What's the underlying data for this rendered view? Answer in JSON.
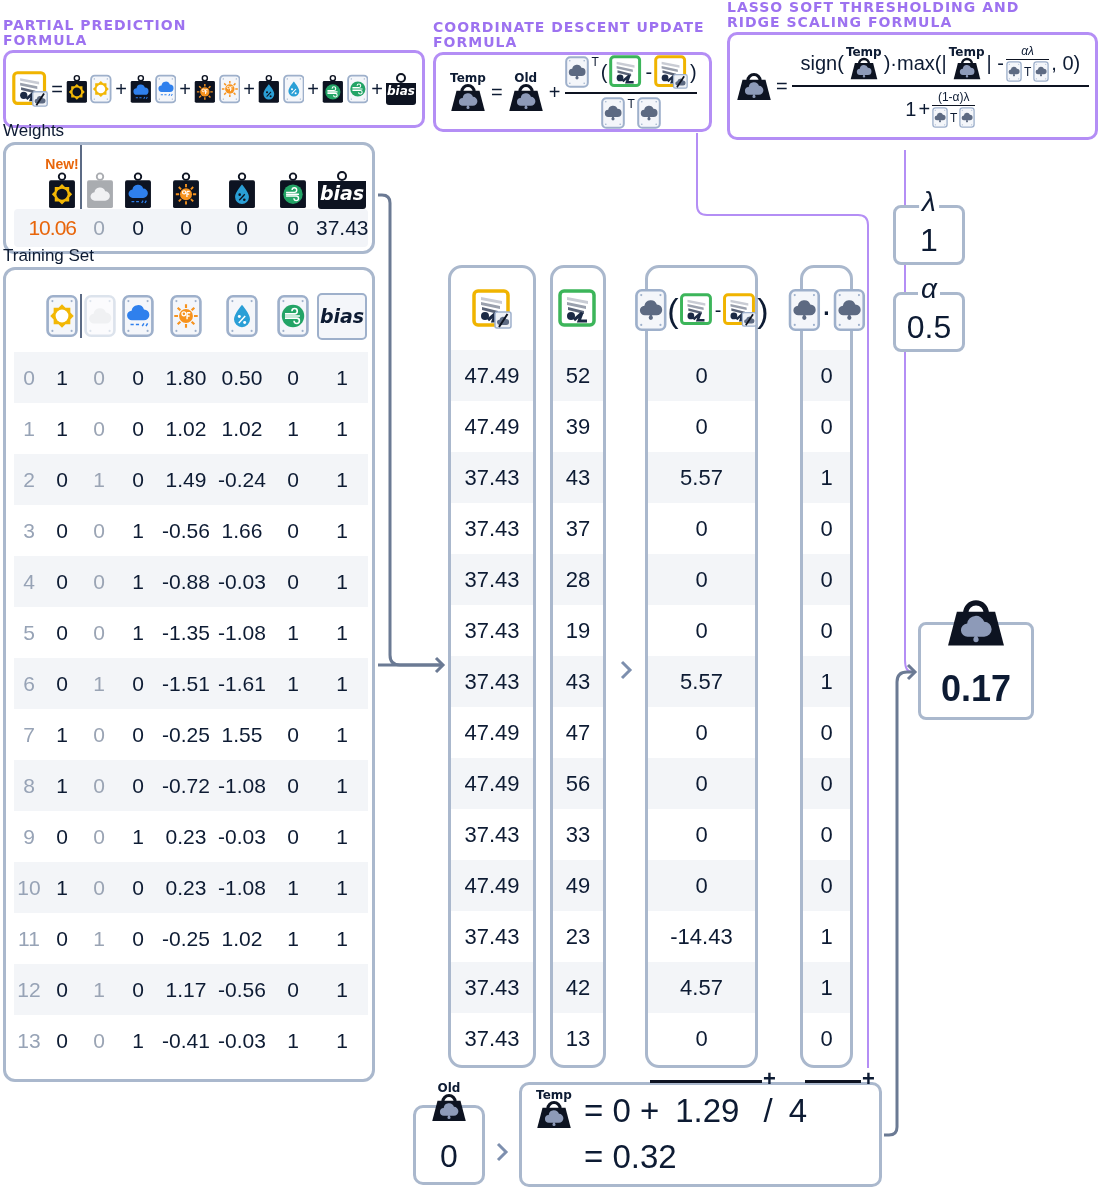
{
  "partial_prediction": {
    "title": "PARTIAL PREDICTION FORMULA",
    "equals": "=",
    "plus_signs": [
      "+",
      "+",
      "+",
      "+",
      "+"
    ],
    "bias_label": "bias"
  },
  "coordinate_update": {
    "title": "COORDINATE DESCENT UPDATE FORMULA",
    "new_label": "Temp",
    "equals": "=",
    "old_label": "Old",
    "plus": "+",
    "numerator": {
      "transpose": "T",
      "open": "(",
      "minus": "-",
      "close": ")"
    },
    "denominator": {
      "transpose": "T"
    }
  },
  "lasso_update": {
    "title": "LASSO SOFT THRESHOLDING AND RIDGE SCALING FORMULA",
    "equals": "=",
    "numerator": {
      "sign_open": "sign(",
      "temp_label_1": "Temp",
      "max_open": ")·max(|",
      "temp_label_2": "Temp",
      "abs_close": "| -",
      "penalty": "αλ",
      "penalty_transpose": "T",
      "tail": ", 0)"
    },
    "denominator": {
      "one": "1",
      "plus": "+",
      "ridge": "(1-α)λ",
      "ridge_transpose": "T"
    }
  },
  "weights": {
    "title": "Weights",
    "items": [
      {
        "kind": "sun",
        "badge": "New!",
        "value": "10.06",
        "highlighted": true,
        "faded": false
      },
      {
        "kind": "cloud",
        "value": "0",
        "highlighted": false,
        "faded": true
      },
      {
        "kind": "rain",
        "value": "0",
        "highlighted": false,
        "faded": false
      },
      {
        "kind": "heat",
        "value": "0",
        "highlighted": false,
        "faded": false
      },
      {
        "kind": "humidity",
        "value": "0",
        "highlighted": false,
        "faded": false
      },
      {
        "kind": "wind",
        "value": "0",
        "highlighted": false,
        "faded": false
      },
      {
        "kind": "bias",
        "label": "bias",
        "value": "37.43",
        "highlighted": false,
        "faded": false
      }
    ]
  },
  "training_set": {
    "title": "Training Set",
    "columns": [
      {
        "kind": "sun",
        "faded": false
      },
      {
        "kind": "cloud",
        "faded": true
      },
      {
        "kind": "rain",
        "faded": false
      },
      {
        "kind": "heat",
        "faded": false
      },
      {
        "kind": "humidity",
        "faded": false
      },
      {
        "kind": "wind",
        "faded": false
      },
      {
        "kind": "bias",
        "label": "bias",
        "faded": false
      }
    ],
    "rows": [
      {
        "index": "0",
        "cells": [
          "1",
          "0",
          "0",
          "1.80",
          "0.50",
          "0",
          "1"
        ]
      },
      {
        "index": "1",
        "cells": [
          "1",
          "0",
          "0",
          "1.02",
          "1.02",
          "1",
          "1"
        ]
      },
      {
        "index": "2",
        "cells": [
          "0",
          "1",
          "0",
          "1.49",
          "-0.24",
          "0",
          "1"
        ]
      },
      {
        "index": "3",
        "cells": [
          "0",
          "0",
          "1",
          "-0.56",
          "1.66",
          "0",
          "1"
        ]
      },
      {
        "index": "4",
        "cells": [
          "0",
          "0",
          "1",
          "-0.88",
          "-0.03",
          "0",
          "1"
        ]
      },
      {
        "index": "5",
        "cells": [
          "0",
          "0",
          "1",
          "-1.35",
          "-1.08",
          "1",
          "1"
        ]
      },
      {
        "index": "6",
        "cells": [
          "0",
          "1",
          "0",
          "-1.51",
          "-1.61",
          "1",
          "1"
        ]
      },
      {
        "index": "7",
        "cells": [
          "1",
          "0",
          "0",
          "-0.25",
          "1.55",
          "0",
          "1"
        ]
      },
      {
        "index": "8",
        "cells": [
          "1",
          "0",
          "0",
          "-0.72",
          "-1.08",
          "0",
          "1"
        ]
      },
      {
        "index": "9",
        "cells": [
          "0",
          "0",
          "1",
          "0.23",
          "-0.03",
          "0",
          "1"
        ]
      },
      {
        "index": "10",
        "cells": [
          "1",
          "0",
          "0",
          "0.23",
          "-1.08",
          "1",
          "1"
        ]
      },
      {
        "index": "11",
        "cells": [
          "0",
          "1",
          "0",
          "-0.25",
          "1.02",
          "1",
          "1"
        ]
      },
      {
        "index": "12",
        "cells": [
          "0",
          "1",
          "0",
          "1.17",
          "-0.56",
          "0",
          "1"
        ]
      },
      {
        "index": "13",
        "cells": [
          "0",
          "0",
          "1",
          "-0.41",
          "-0.03",
          "1",
          "1"
        ]
      }
    ]
  },
  "computation": {
    "residual_header": {
      "open": "(",
      "minus": "-",
      "close": ")"
    },
    "product_header": {
      "dot": "·"
    },
    "rows": [
      {
        "prediction": "47.49",
        "target": "52",
        "residual": "0",
        "product": "0"
      },
      {
        "prediction": "47.49",
        "target": "39",
        "residual": "0",
        "product": "0"
      },
      {
        "prediction": "37.43",
        "target": "43",
        "residual": "5.57",
        "product": "1"
      },
      {
        "prediction": "37.43",
        "target": "37",
        "residual": "0",
        "product": "0"
      },
      {
        "prediction": "37.43",
        "target": "28",
        "residual": "0",
        "product": "0"
      },
      {
        "prediction": "37.43",
        "target": "19",
        "residual": "0",
        "product": "0"
      },
      {
        "prediction": "37.43",
        "target": "43",
        "residual": "5.57",
        "product": "1"
      },
      {
        "prediction": "47.49",
        "target": "47",
        "residual": "0",
        "product": "0"
      },
      {
        "prediction": "47.49",
        "target": "56",
        "residual": "0",
        "product": "0"
      },
      {
        "prediction": "37.43",
        "target": "33",
        "residual": "0",
        "product": "0"
      },
      {
        "prediction": "47.49",
        "target": "49",
        "residual": "0",
        "product": "0"
      },
      {
        "prediction": "37.43",
        "target": "23",
        "residual": "-14.43",
        "product": "1"
      },
      {
        "prediction": "37.43",
        "target": "42",
        "residual": "4.57",
        "product": "1"
      },
      {
        "prediction": "37.43",
        "target": "13",
        "residual": "0",
        "product": "0"
      }
    ]
  },
  "parameters": [
    {
      "symbol": "λ",
      "value": "1"
    },
    {
      "symbol": "α",
      "value": "0.5"
    }
  ],
  "result": {
    "value": "0.17"
  },
  "old_weight": {
    "label": "Old",
    "value": "0"
  },
  "temp_update": {
    "label": "Temp",
    "sum_marks": [
      "+",
      "+"
    ],
    "expression": [
      "= 0 +",
      "1.29",
      "/",
      "4"
    ],
    "result": "= 0.32"
  }
}
